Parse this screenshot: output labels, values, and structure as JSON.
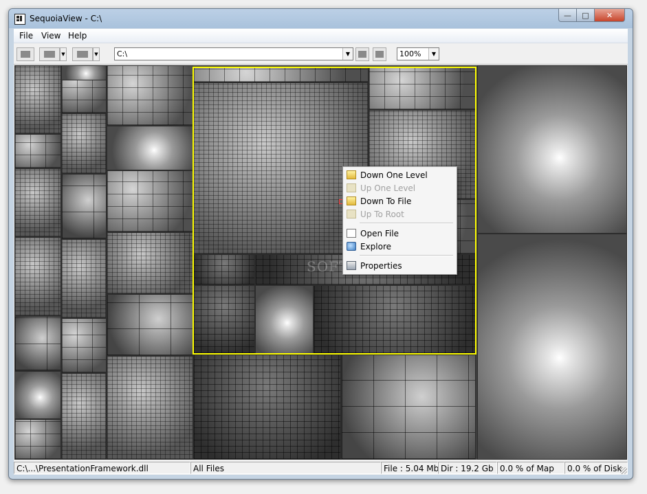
{
  "window": {
    "title": "SequoiaView - C:\\"
  },
  "menu": [
    "File",
    "View",
    "Help"
  ],
  "toolbar": {
    "path": "C:\\",
    "zoom": "100%"
  },
  "context_menu": {
    "items": [
      {
        "label": "Down One Level",
        "enabled": true,
        "icon": "folder-down-icon"
      },
      {
        "label": "Up One Level",
        "enabled": false,
        "icon": "folder-up-icon"
      },
      {
        "label": "Down To File",
        "enabled": true,
        "icon": "folder-file-icon"
      },
      {
        "label": "Up To Root",
        "enabled": false,
        "icon": "root-icon"
      },
      {
        "label": "Open File",
        "enabled": true,
        "icon": "file-icon"
      },
      {
        "label": "Explore",
        "enabled": true,
        "icon": "explore-icon"
      },
      {
        "label": "Properties",
        "enabled": true,
        "icon": "properties-icon"
      }
    ]
  },
  "watermark": "SOFTPEDIA",
  "status": {
    "path": "C:\\...\\PresentationFramework.dll",
    "filter": "All Files",
    "file": "File : 5.04 Mb",
    "dir": "Dir : 19.2 Gb",
    "map": "0.0 % of Map",
    "disk": "0.0 % of Disk"
  }
}
